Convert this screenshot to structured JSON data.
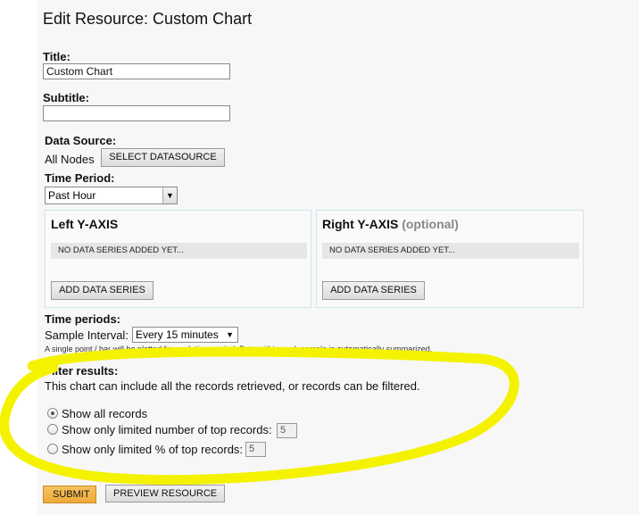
{
  "page_title": "Edit Resource: Custom Chart",
  "title_field": {
    "label": "Title:",
    "value": "Custom Chart",
    "placeholder": ""
  },
  "subtitle_field": {
    "label": "Subtitle:",
    "value": ""
  },
  "data_source": {
    "label": "Data Source:",
    "value": "All Nodes",
    "button": "SELECT DATASOURCE"
  },
  "time_period": {
    "label": "Time Period:",
    "selected": "Past Hour"
  },
  "left_axis": {
    "title": "Left Y-AXIS",
    "empty_text": "NO DATA SERIES ADDED YET...",
    "button": "ADD DATA SERIES"
  },
  "right_axis": {
    "title": "Right Y-AXIS",
    "optional": "(optional)",
    "empty_text": "NO DATA SERIES ADDED YET...",
    "button": "ADD DATA SERIES"
  },
  "time_periods": {
    "label": "Time periods:",
    "sample_label": "Sample Interval:",
    "sample_selected": "Every 15 minutes",
    "note": "A single point / bar will be plotted for each time period. Data within each sample is automatically summarized."
  },
  "filter": {
    "label": "Filter results:",
    "description": "This chart can include all the records retrieved, or records can be filtered.",
    "options": [
      {
        "label": "Show all records",
        "checked": true
      },
      {
        "label": "Show only limited number of top records:",
        "value": "5",
        "checked": false
      },
      {
        "label": "Show only limited % of top records:",
        "value": "5",
        "checked": false
      }
    ]
  },
  "actions": {
    "submit": "SUBMIT",
    "preview": "PREVIEW RESOURCE"
  },
  "colors": {
    "highlight": "#f5f200",
    "submit": "#f0b040",
    "panel_border": "#cfe3ec"
  }
}
